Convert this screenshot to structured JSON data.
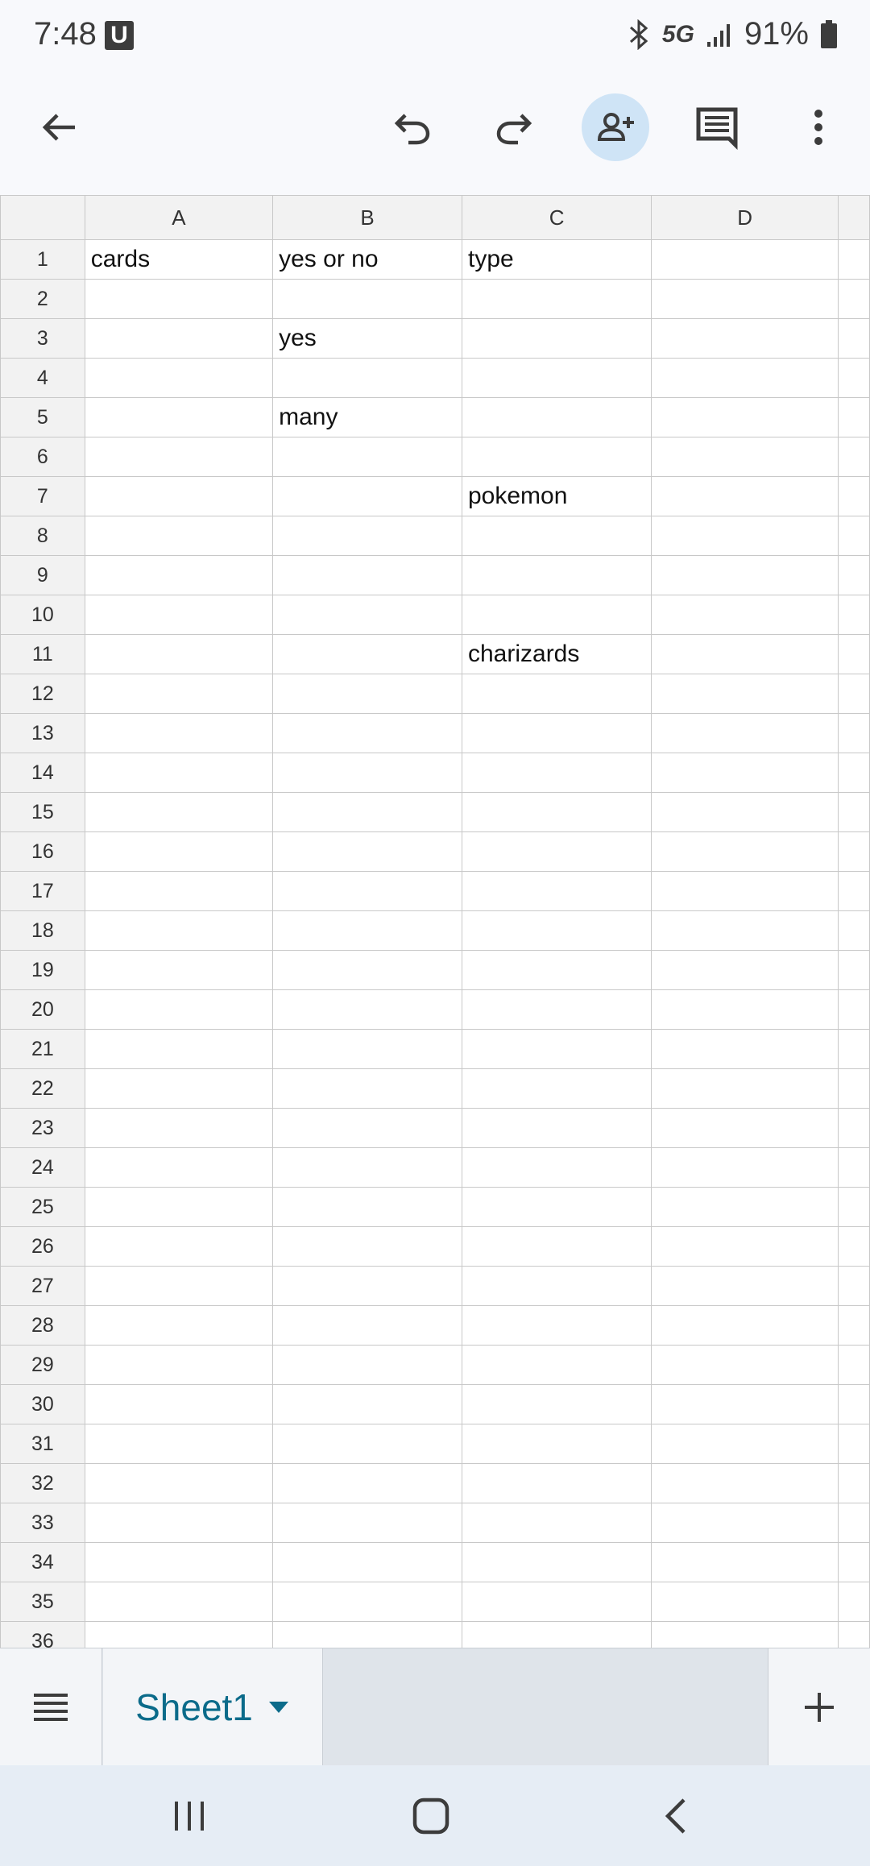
{
  "status_bar": {
    "time": "7:48",
    "notification": "U",
    "network": "5G",
    "battery": "91%"
  },
  "toolbar": {
    "back_icon": "arrow-back-icon",
    "undo_icon": "undo-icon",
    "redo_icon": "redo-icon",
    "share_icon": "person-add-icon",
    "comment_icon": "comment-icon",
    "more_icon": "more-vert-icon",
    "accent_color": "#cfe4f6"
  },
  "grid": {
    "columns": [
      "A",
      "B",
      "C",
      "D"
    ],
    "rows": [
      {
        "num": "1",
        "cells": [
          "cards",
          "yes or no",
          "type",
          ""
        ]
      },
      {
        "num": "2",
        "cells": [
          "",
          "",
          "",
          ""
        ]
      },
      {
        "num": "3",
        "cells": [
          "",
          "yes",
          "",
          ""
        ]
      },
      {
        "num": "4",
        "cells": [
          "",
          "",
          "",
          ""
        ]
      },
      {
        "num": "5",
        "cells": [
          "",
          "many",
          "",
          ""
        ]
      },
      {
        "num": "6",
        "cells": [
          "",
          "",
          "",
          ""
        ]
      },
      {
        "num": "7",
        "cells": [
          "",
          "",
          "pokemon",
          ""
        ]
      },
      {
        "num": "8",
        "cells": [
          "",
          "",
          "",
          ""
        ]
      },
      {
        "num": "9",
        "cells": [
          "",
          "",
          "",
          ""
        ]
      },
      {
        "num": "10",
        "cells": [
          "",
          "",
          "",
          ""
        ]
      },
      {
        "num": "11",
        "cells": [
          "",
          "",
          "charizards",
          ""
        ]
      },
      {
        "num": "12",
        "cells": [
          "",
          "",
          "",
          ""
        ]
      },
      {
        "num": "13",
        "cells": [
          "",
          "",
          "",
          ""
        ]
      },
      {
        "num": "14",
        "cells": [
          "",
          "",
          "",
          ""
        ]
      },
      {
        "num": "15",
        "cells": [
          "",
          "",
          "",
          ""
        ]
      },
      {
        "num": "16",
        "cells": [
          "",
          "",
          "",
          ""
        ]
      },
      {
        "num": "17",
        "cells": [
          "",
          "",
          "",
          ""
        ]
      },
      {
        "num": "18",
        "cells": [
          "",
          "",
          "",
          ""
        ]
      },
      {
        "num": "19",
        "cells": [
          "",
          "",
          "",
          ""
        ]
      },
      {
        "num": "20",
        "cells": [
          "",
          "",
          "",
          ""
        ]
      },
      {
        "num": "21",
        "cells": [
          "",
          "",
          "",
          ""
        ]
      },
      {
        "num": "22",
        "cells": [
          "",
          "",
          "",
          ""
        ]
      },
      {
        "num": "23",
        "cells": [
          "",
          "",
          "",
          ""
        ]
      },
      {
        "num": "24",
        "cells": [
          "",
          "",
          "",
          ""
        ]
      },
      {
        "num": "25",
        "cells": [
          "",
          "",
          "",
          ""
        ]
      },
      {
        "num": "26",
        "cells": [
          "",
          "",
          "",
          ""
        ]
      },
      {
        "num": "27",
        "cells": [
          "",
          "",
          "",
          ""
        ]
      },
      {
        "num": "28",
        "cells": [
          "",
          "",
          "",
          ""
        ]
      },
      {
        "num": "29",
        "cells": [
          "",
          "",
          "",
          ""
        ]
      },
      {
        "num": "30",
        "cells": [
          "",
          "",
          "",
          ""
        ]
      },
      {
        "num": "31",
        "cells": [
          "",
          "",
          "",
          ""
        ]
      },
      {
        "num": "32",
        "cells": [
          "",
          "",
          "",
          ""
        ]
      },
      {
        "num": "33",
        "cells": [
          "",
          "",
          "",
          ""
        ]
      },
      {
        "num": "34",
        "cells": [
          "",
          "",
          "",
          ""
        ]
      },
      {
        "num": "35",
        "cells": [
          "",
          "",
          "",
          ""
        ]
      },
      {
        "num": "36",
        "cells": [
          "",
          "",
          "",
          ""
        ]
      }
    ]
  },
  "sheets": {
    "menu_icon": "menu-icon",
    "active_sheet": "Sheet1",
    "dropdown_icon": "caret-down-icon",
    "add_icon": "plus-icon",
    "tab_color": "#0b6b8a"
  },
  "nav_bar": {
    "recents_icon": "recents-icon",
    "home_icon": "home-icon",
    "back_icon": "nav-back-icon"
  }
}
